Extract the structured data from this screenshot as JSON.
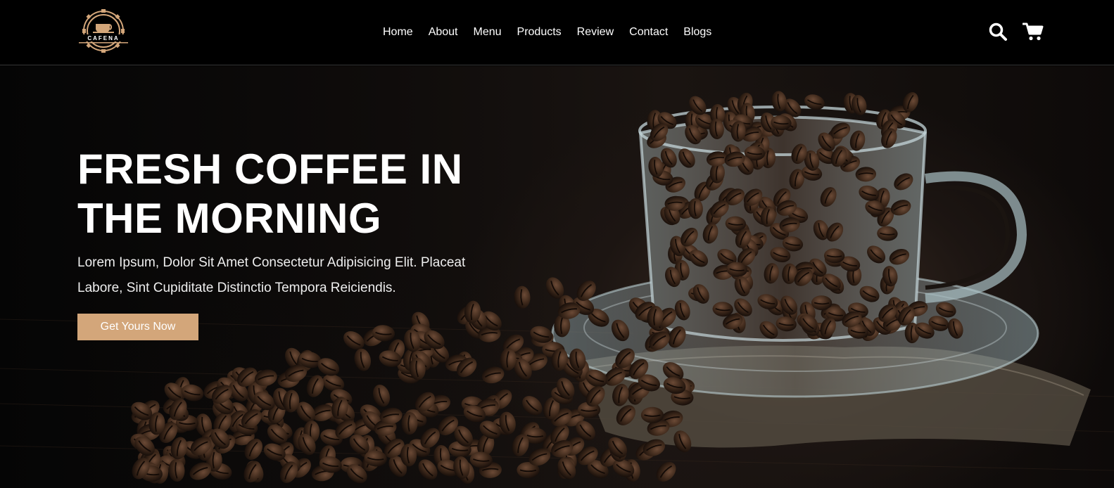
{
  "brand": {
    "logo_text": "CAFENA",
    "logo_icon": "coffee-cup-gear-logo",
    "accent": "#d3a67a"
  },
  "nav": {
    "items": [
      {
        "label": "Home"
      },
      {
        "label": "About"
      },
      {
        "label": "Menu"
      },
      {
        "label": "Products"
      },
      {
        "label": "Review"
      },
      {
        "label": "Contact"
      },
      {
        "label": "Blogs"
      }
    ]
  },
  "header_icons": {
    "search": "search-icon",
    "cart": "shopping-cart-icon"
  },
  "hero": {
    "title_line1": "FRESH COFFEE IN",
    "title_line2": "THE MORNING",
    "text_line1": "Lorem Ipsum, Dolor Sit Amet Consectetur Adipisicing Elit. Placeat",
    "text_line2": "Labore, Sint Cupiditate Distinctio Tempora Reiciendis.",
    "cta_label": "Get Yours Now"
  }
}
